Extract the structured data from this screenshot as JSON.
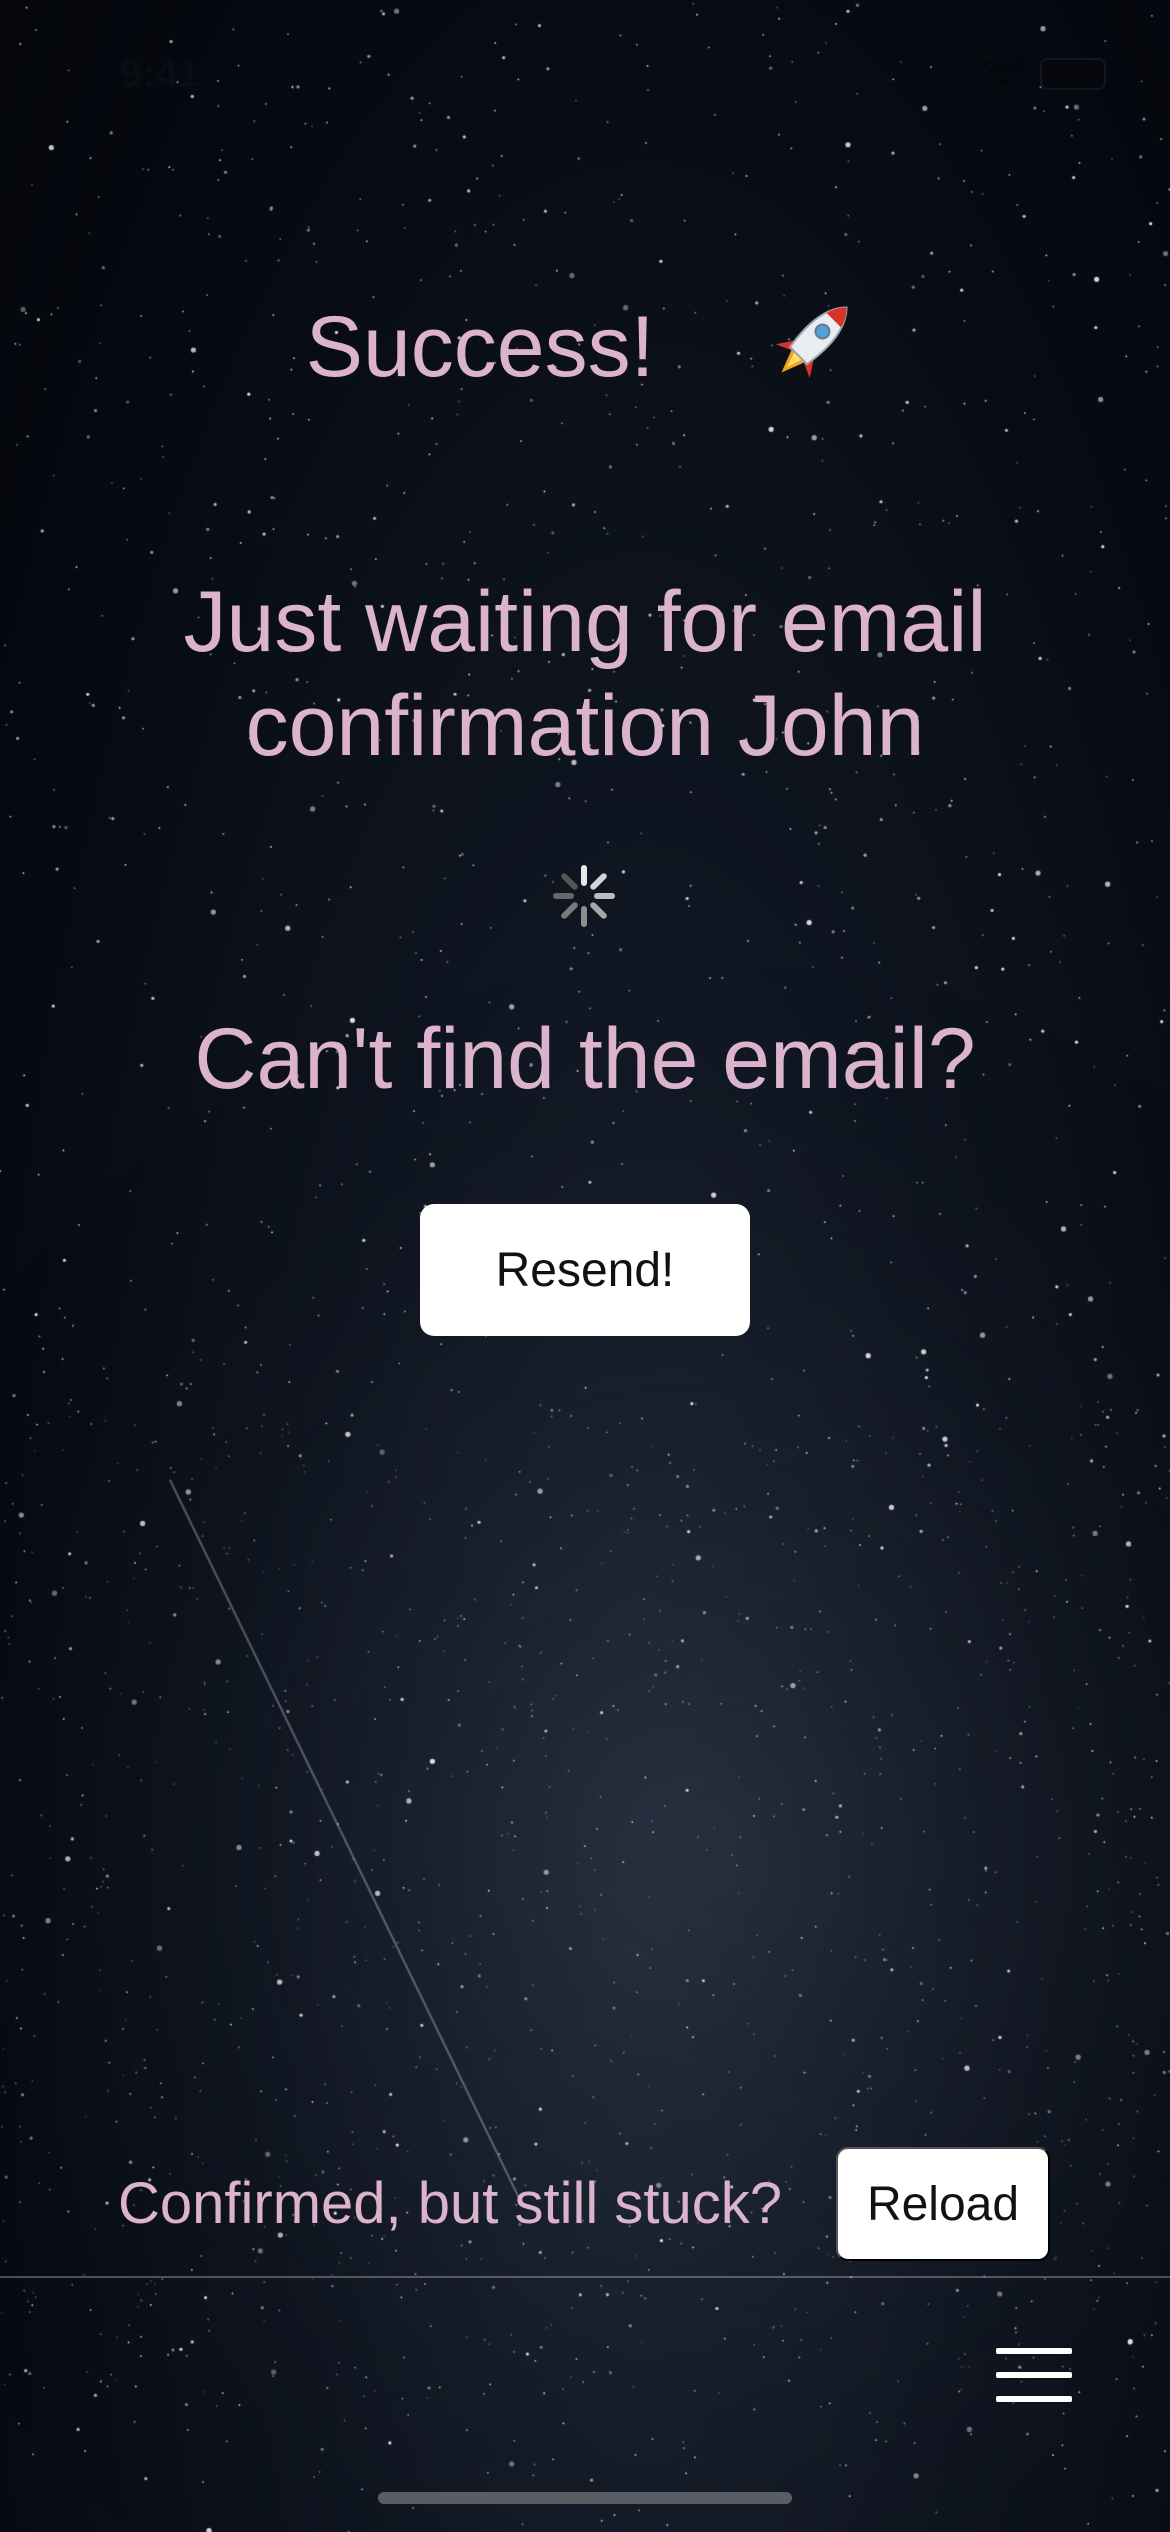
{
  "status_bar": {
    "time": "9:41",
    "icons": [
      "wifi-icon",
      "battery-icon"
    ]
  },
  "header": {
    "title": "Success!",
    "icon": "rocket-icon"
  },
  "main": {
    "waiting_message": "Just waiting for email confirmation John",
    "loading_icon": "spinner-icon",
    "cant_find_prompt": "Can't find the email?",
    "resend_label": "Resend!"
  },
  "footer": {
    "stuck_prompt": "Confirmed, but still stuck?",
    "reload_label": "Reload",
    "menu_icon": "hamburger-menu-icon"
  },
  "colors": {
    "accent_text": "#dcb3cc",
    "button_background": "#ffffff",
    "background": "#070a12"
  }
}
